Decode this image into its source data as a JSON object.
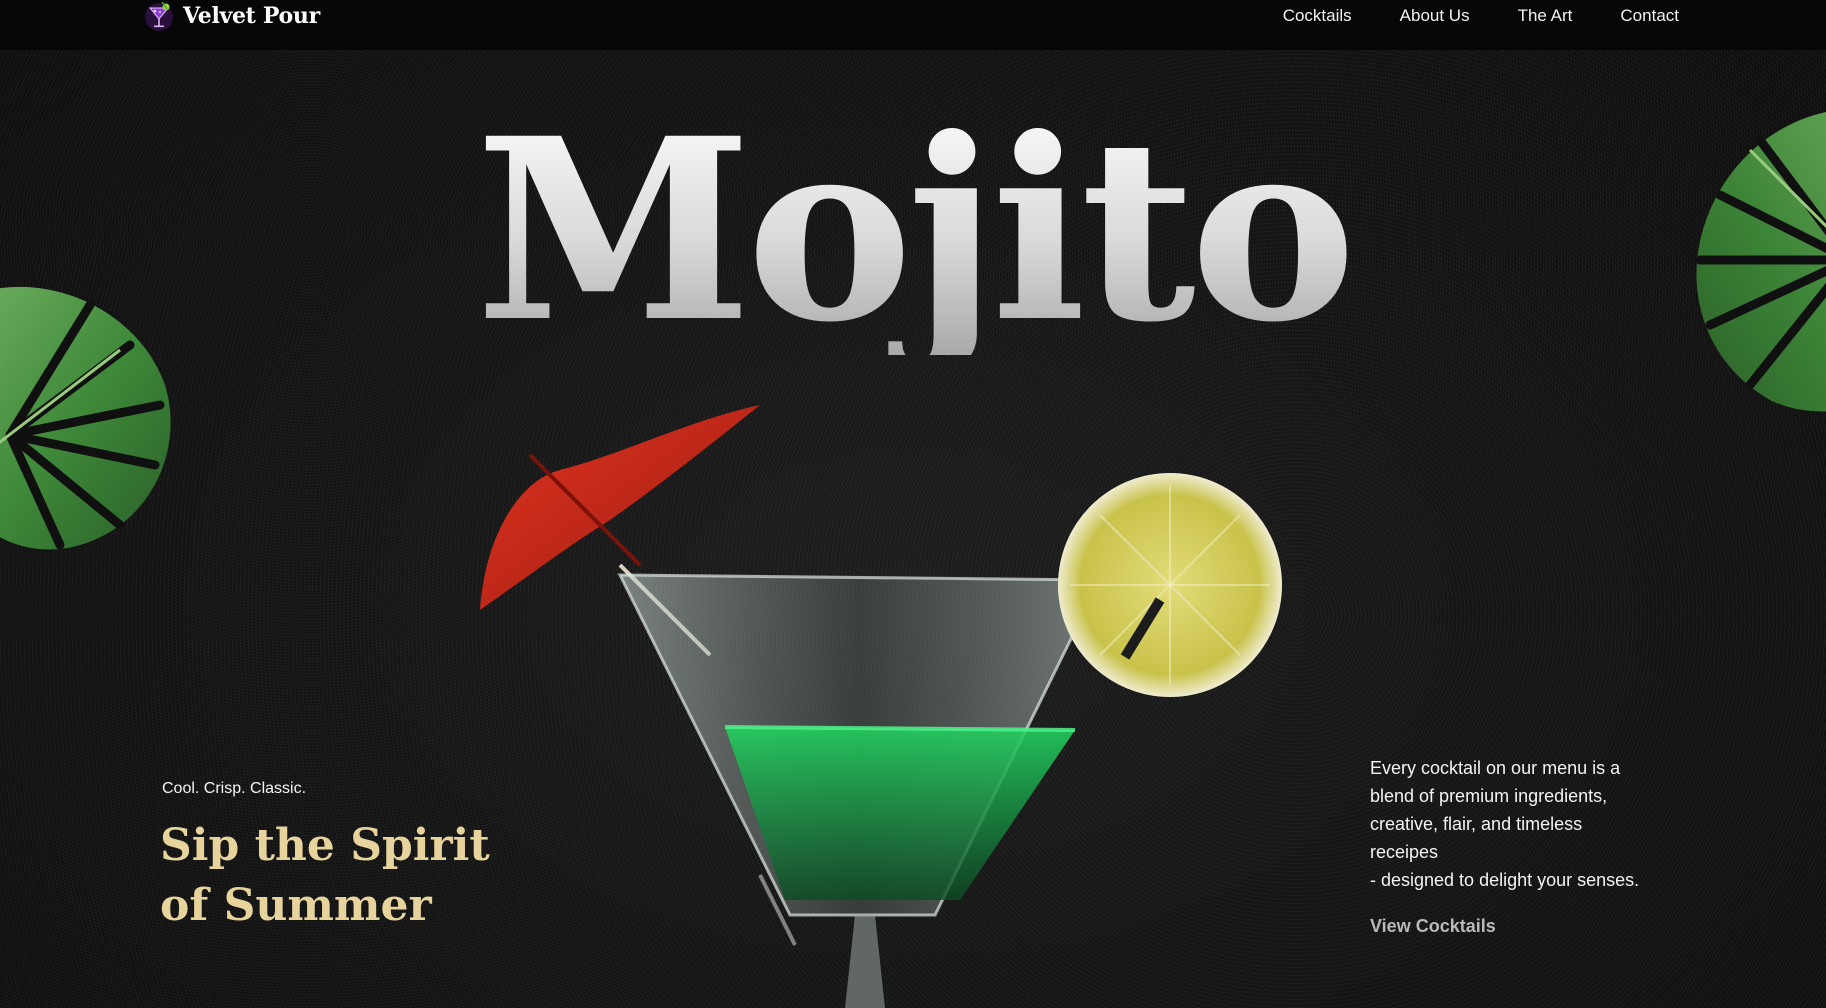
{
  "brand": {
    "name": "Velvet Pour",
    "logo_icon": "cocktail-glass-icon"
  },
  "nav": {
    "links": [
      {
        "label": "Cocktails"
      },
      {
        "label": "About Us"
      },
      {
        "label": "The Art"
      },
      {
        "label": "Contact"
      }
    ]
  },
  "hero": {
    "title": "Mojito",
    "tagline": "Cool. Crisp. Classic.",
    "headline_line1": "Sip the Spirit",
    "headline_line2": "of Summer",
    "description_lines": [
      "Every cocktail on our menu is a",
      "blend of premium ingredients,",
      "creative, flair, and timeless",
      "receipes",
      "- designed to delight your senses."
    ],
    "cta_label": "View Cocktails",
    "images": {
      "left_leaf": "monstera-leaf-icon",
      "right_leaf": "monstera-leaf-icon",
      "drink": "mojito-cocktail-glass"
    }
  },
  "colors": {
    "background": "#101010",
    "navbar": "#060606",
    "headline_gold": "#e7d39c",
    "title_silver": "#d9d9d9",
    "cta_gray": "#b9b9b9",
    "umbrella_red": "#c8231a",
    "lime_yellow": "#c9c24a",
    "leaf_green": "#3f8a3a"
  }
}
